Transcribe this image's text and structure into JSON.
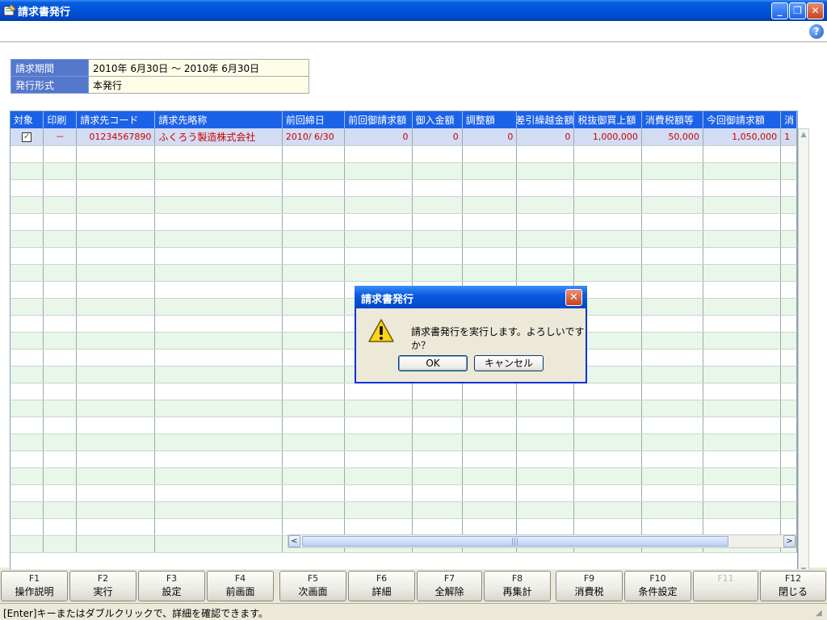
{
  "window": {
    "title": "請求書発行",
    "min_glyph": "_",
    "max_glyph": "❐",
    "close_glyph": "✕",
    "help_glyph": "?"
  },
  "info": [
    {
      "label": "請求期間",
      "value": "2010年 6月30日 ～ 2010年 6月30日"
    },
    {
      "label": "発行形式",
      "value": "本発行"
    }
  ],
  "grid": {
    "columns": [
      "対象",
      "印刷",
      "請求先コード",
      "請求先略称",
      "前回締日",
      "前回御請求額",
      "御入金額",
      "調整額",
      "差引繰越金額",
      "税抜御買上額",
      "消費税額等",
      "今回御請求額",
      "消"
    ],
    "rows": [
      {
        "checked": "✓",
        "print": "－",
        "code": "01234567890",
        "name": "ふくろう製造株式会社",
        "prev_date": "2010/ 6/30",
        "prev_amount": "0",
        "payment": "0",
        "adjust": "0",
        "carry": "0",
        "sales": "1,000,000",
        "tax": "50,000",
        "total": "1,050,000",
        "extra": "1"
      }
    ]
  },
  "scroll": {
    "up": "▲",
    "down": "▼",
    "left": "<",
    "right": ">",
    "grip": "|||"
  },
  "fkeys": [
    {
      "key": "F1",
      "label": "操作説明"
    },
    {
      "key": "F2",
      "label": "実行"
    },
    {
      "key": "F3",
      "label": "設定"
    },
    {
      "key": "F4",
      "label": "前画面"
    },
    {
      "key": "F5",
      "label": "次画面"
    },
    {
      "key": "F6",
      "label": "詳細"
    },
    {
      "key": "F7",
      "label": "全解除"
    },
    {
      "key": "F8",
      "label": "再集計"
    },
    {
      "key": "F9",
      "label": "消費税"
    },
    {
      "key": "F10",
      "label": "条件設定"
    },
    {
      "key": "F11",
      "label": ""
    },
    {
      "key": "F12",
      "label": "閉じる"
    }
  ],
  "status": "[Enter]キーまたはダブルクリックで、詳細を確認できます。",
  "dialog": {
    "title": "請求書発行",
    "message": "請求書発行を実行します。よろしいですか？",
    "ok": "OK",
    "cancel": "キャンセル",
    "close_glyph": "✕"
  }
}
